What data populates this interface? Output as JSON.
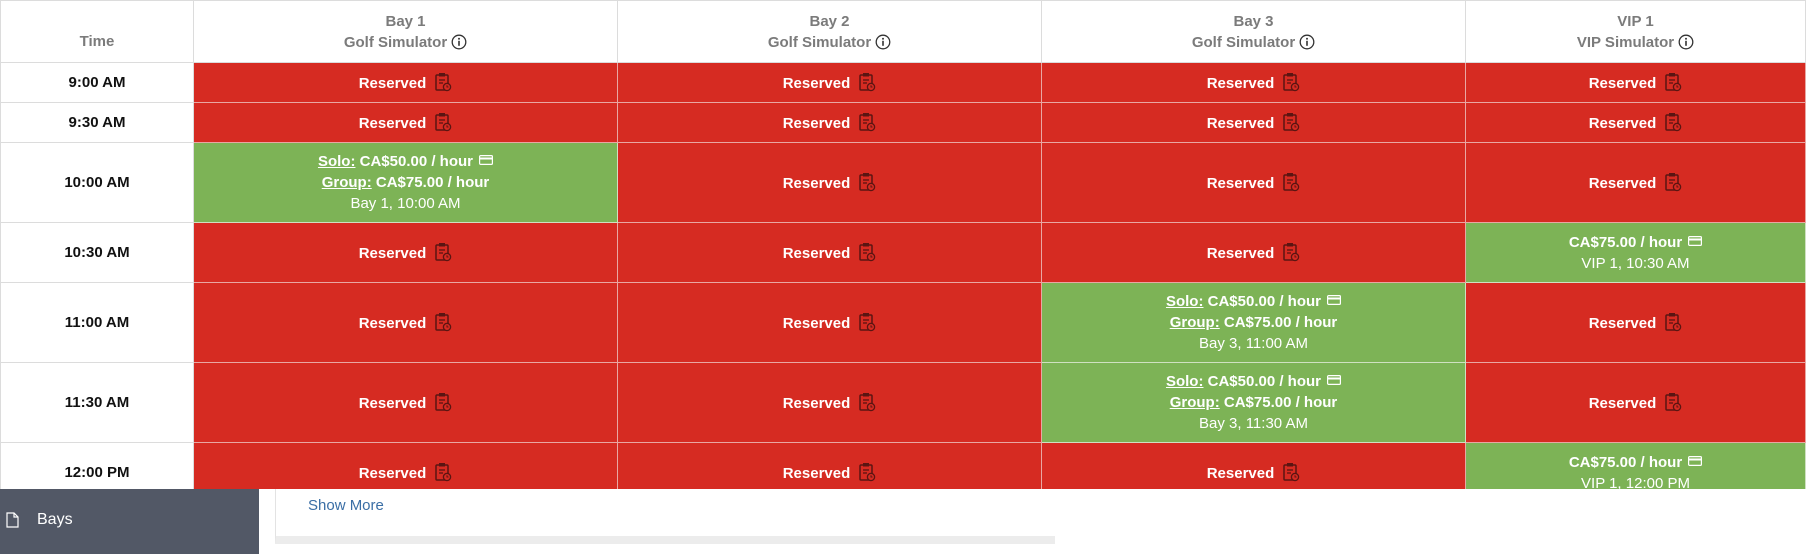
{
  "columns": {
    "time": "Time",
    "bay1": {
      "name": "Bay 1",
      "type": "Golf Simulator"
    },
    "bay2": {
      "name": "Bay 2",
      "type": "Golf Simulator"
    },
    "bay3": {
      "name": "Bay 3",
      "type": "Golf Simulator"
    },
    "vip1": {
      "name": "VIP 1",
      "type": "VIP Simulator"
    }
  },
  "labels": {
    "reserved": "Reserved",
    "solo": "Solo:",
    "group": "Group:",
    "solo_price": "CA$50.00 / hour",
    "group_price": "CA$75.00 / hour",
    "vip_price": "CA$75.00 / hour"
  },
  "times": [
    "9:00 AM",
    "9:30 AM",
    "10:00 AM",
    "10:30 AM",
    "11:00 AM",
    "11:30 AM",
    "12:00 PM"
  ],
  "slots": {
    "bay1_1000": "Bay 1, 10:00 AM",
    "vip1_1030": "VIP 1, 10:30 AM",
    "bay3_1100": "Bay 3, 11:00 AM",
    "bay3_1130": "Bay 3, 11:30 AM",
    "vip1_1200": "VIP 1, 12:00 PM"
  },
  "sidebar": {
    "bays": "Bays"
  },
  "footer": {
    "show_more": "Show More"
  },
  "colors": {
    "reserved": "#d62b22",
    "available": "#7db356",
    "sidebar": "#525866",
    "link": "#3a6ea5"
  },
  "icons": [
    "info-icon",
    "calendar-clock-icon",
    "credit-card-icon",
    "document-icon"
  ]
}
